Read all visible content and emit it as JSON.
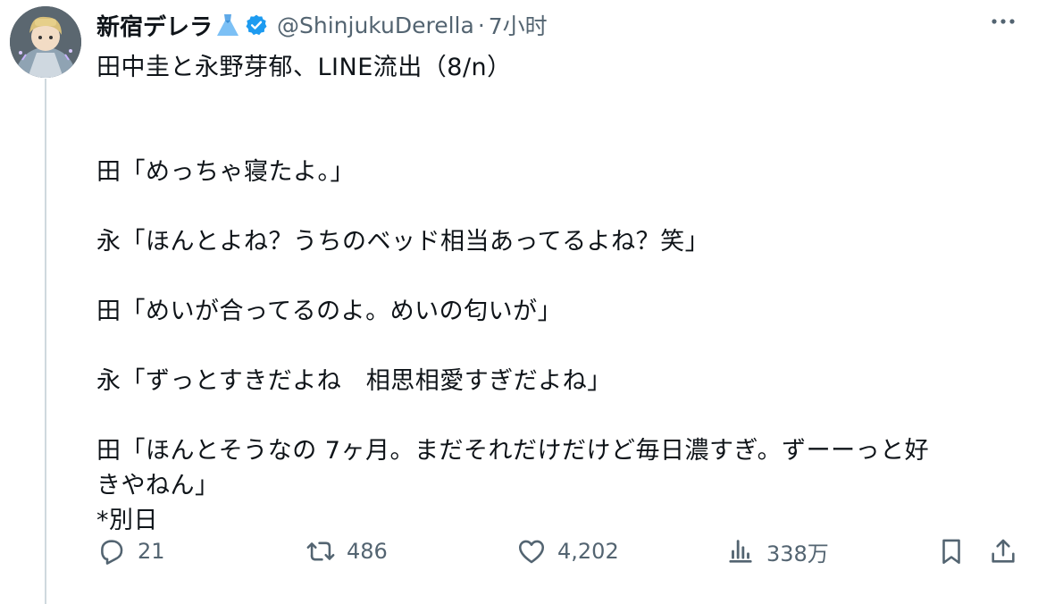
{
  "author": {
    "display_name": "新宿デレラ",
    "handle": "@ShinjukuDerella",
    "separator": "·",
    "time": "7小时",
    "verified": true
  },
  "tweet": {
    "lines": [
      "田中圭と永野芽郁、LINE流出（8/n）",
      "",
      "田「めっちゃ寝たよ。」",
      "",
      "永「ほんとよね？うちのベッド相当あってるよね？笑」",
      "",
      "田「めいが合ってるのよ。めいの匂いが」",
      "",
      "永「ずっとすきだよね　相思相愛すぎだよね」",
      "",
      "田「ほんとそうなの 7ヶ月。まだそれだけだけど毎日濃すぎ。ずーーっと好",
      "きやねん」",
      "*別日"
    ]
  },
  "actions": {
    "replies": "21",
    "retweets": "486",
    "likes": "4,202",
    "views": "338万"
  },
  "colors": {
    "text": "#0f1419",
    "secondary": "#536471",
    "verified": "#1d9bf0",
    "thread_line": "#cfd9de"
  },
  "icons": [
    "avatar",
    "dress-icon",
    "verified-icon",
    "more-icon",
    "reply-icon",
    "retweet-icon",
    "like-icon",
    "views-icon",
    "bookmark-icon",
    "share-icon"
  ]
}
